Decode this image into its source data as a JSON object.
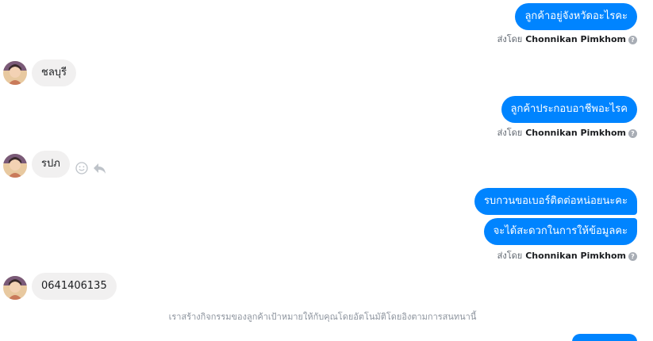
{
  "sender_label": "ส่งโดย",
  "sender_name": "Chonnikan Pimkhom",
  "info_glyph": "?",
  "colors": {
    "outgoing_bubble": "#0084ff",
    "incoming_bubble": "#f1f0f0",
    "meta_text": "#606770"
  },
  "messages": {
    "out_1": "ลูกค้าอยู่จังหวัดอะไรคะ",
    "in_1": "ชลบุรี",
    "out_2": "ลูกค้าประกอบอาชีพอะไรค",
    "in_2": "รปภ",
    "out_3": "รบกวนขอเบอร์ติดต่อหน่อยนะคะ",
    "out_4": "จะได้สะดวกในการให้ข้อมูลคะ",
    "in_3": "0641406135"
  },
  "notice": "เราสร้างกิจกรรมของลูกค้าเป้าหมายให้กับคุณโดยอัตโนมัติโดยอิงตามการสนทนานี้",
  "icons": {
    "avatar": "avatar-icon",
    "react": "smiley-icon",
    "reply": "reply-icon",
    "info": "info-icon"
  }
}
